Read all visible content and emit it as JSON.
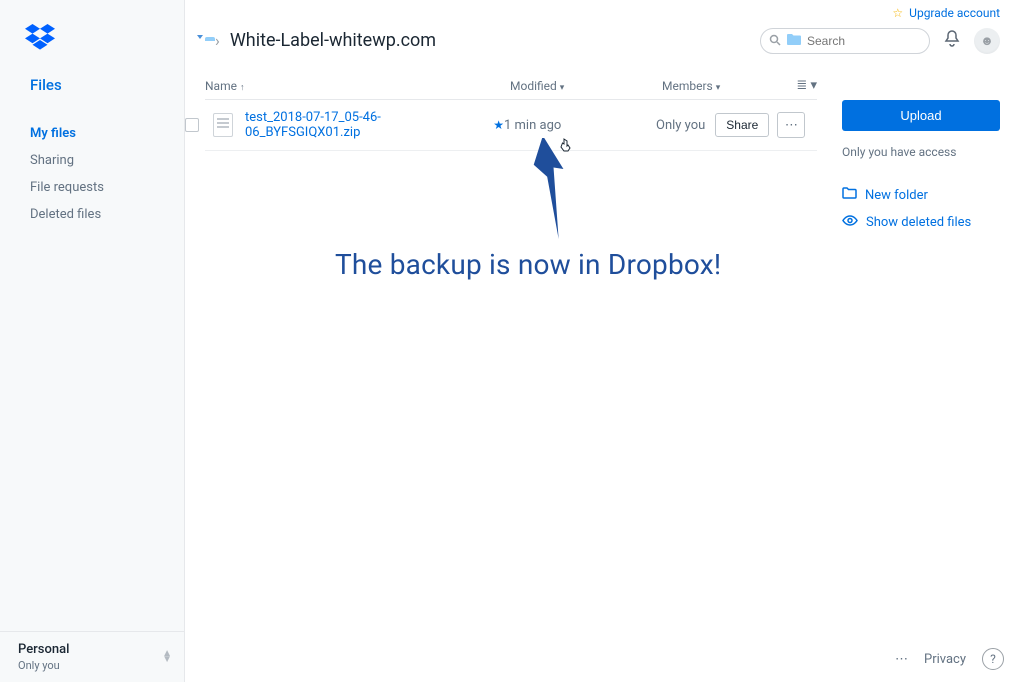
{
  "topbar": {
    "upgrade_label": "Upgrade account",
    "search_placeholder": "Search"
  },
  "sidebar": {
    "section_title": "Files",
    "items": [
      {
        "label": "My files"
      },
      {
        "label": "Sharing"
      },
      {
        "label": "File requests"
      },
      {
        "label": "Deleted files"
      }
    ]
  },
  "account": {
    "name": "Personal",
    "subtext": "Only you"
  },
  "breadcrumb": {
    "current": "White-Label-whitewp.com"
  },
  "columns": {
    "name": "Name",
    "modified": "Modified",
    "members": "Members"
  },
  "files": [
    {
      "name": "test_2018-07-17_05-46-06_BYFSGIQX01.zip",
      "modified": "1 min ago",
      "members": "Only you",
      "share_label": "Share"
    }
  ],
  "right_panel": {
    "upload": "Upload",
    "access": "Only you have access",
    "new_folder": "New folder",
    "show_deleted": "Show deleted files"
  },
  "annotation": {
    "text": "The backup is now in Dropbox!"
  },
  "footer": {
    "privacy": "Privacy"
  }
}
